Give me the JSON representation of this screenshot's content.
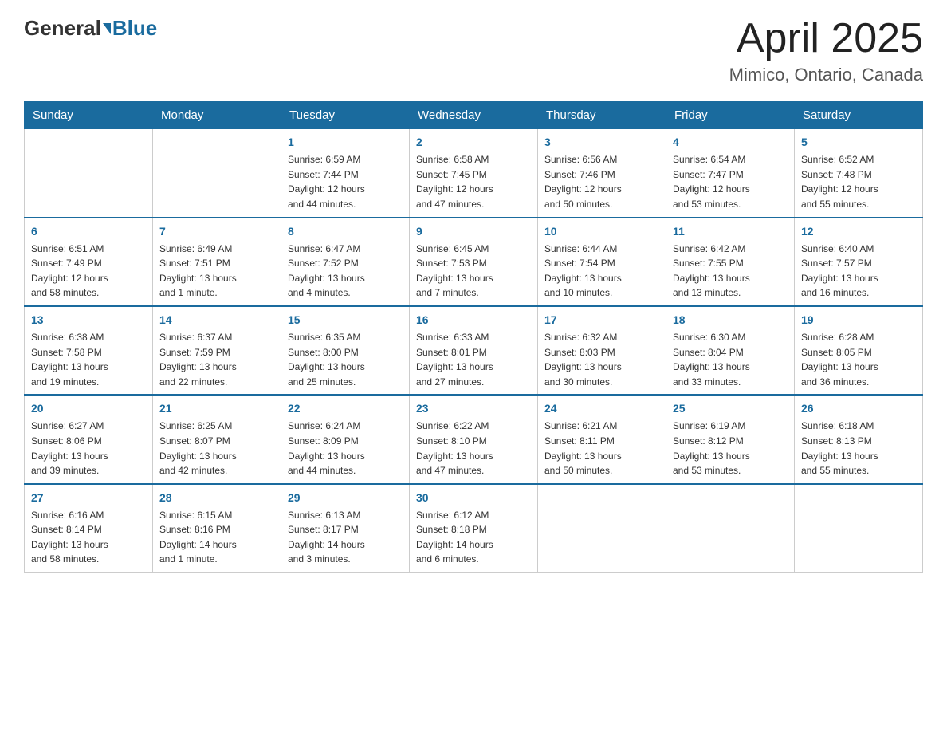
{
  "header": {
    "logo_general": "General",
    "logo_blue": "Blue",
    "month_title": "April 2025",
    "location": "Mimico, Ontario, Canada"
  },
  "weekdays": [
    "Sunday",
    "Monday",
    "Tuesday",
    "Wednesday",
    "Thursday",
    "Friday",
    "Saturday"
  ],
  "weeks": [
    [
      {
        "day": "",
        "info": ""
      },
      {
        "day": "",
        "info": ""
      },
      {
        "day": "1",
        "info": "Sunrise: 6:59 AM\nSunset: 7:44 PM\nDaylight: 12 hours\nand 44 minutes."
      },
      {
        "day": "2",
        "info": "Sunrise: 6:58 AM\nSunset: 7:45 PM\nDaylight: 12 hours\nand 47 minutes."
      },
      {
        "day": "3",
        "info": "Sunrise: 6:56 AM\nSunset: 7:46 PM\nDaylight: 12 hours\nand 50 minutes."
      },
      {
        "day": "4",
        "info": "Sunrise: 6:54 AM\nSunset: 7:47 PM\nDaylight: 12 hours\nand 53 minutes."
      },
      {
        "day": "5",
        "info": "Sunrise: 6:52 AM\nSunset: 7:48 PM\nDaylight: 12 hours\nand 55 minutes."
      }
    ],
    [
      {
        "day": "6",
        "info": "Sunrise: 6:51 AM\nSunset: 7:49 PM\nDaylight: 12 hours\nand 58 minutes."
      },
      {
        "day": "7",
        "info": "Sunrise: 6:49 AM\nSunset: 7:51 PM\nDaylight: 13 hours\nand 1 minute."
      },
      {
        "day": "8",
        "info": "Sunrise: 6:47 AM\nSunset: 7:52 PM\nDaylight: 13 hours\nand 4 minutes."
      },
      {
        "day": "9",
        "info": "Sunrise: 6:45 AM\nSunset: 7:53 PM\nDaylight: 13 hours\nand 7 minutes."
      },
      {
        "day": "10",
        "info": "Sunrise: 6:44 AM\nSunset: 7:54 PM\nDaylight: 13 hours\nand 10 minutes."
      },
      {
        "day": "11",
        "info": "Sunrise: 6:42 AM\nSunset: 7:55 PM\nDaylight: 13 hours\nand 13 minutes."
      },
      {
        "day": "12",
        "info": "Sunrise: 6:40 AM\nSunset: 7:57 PM\nDaylight: 13 hours\nand 16 minutes."
      }
    ],
    [
      {
        "day": "13",
        "info": "Sunrise: 6:38 AM\nSunset: 7:58 PM\nDaylight: 13 hours\nand 19 minutes."
      },
      {
        "day": "14",
        "info": "Sunrise: 6:37 AM\nSunset: 7:59 PM\nDaylight: 13 hours\nand 22 minutes."
      },
      {
        "day": "15",
        "info": "Sunrise: 6:35 AM\nSunset: 8:00 PM\nDaylight: 13 hours\nand 25 minutes."
      },
      {
        "day": "16",
        "info": "Sunrise: 6:33 AM\nSunset: 8:01 PM\nDaylight: 13 hours\nand 27 minutes."
      },
      {
        "day": "17",
        "info": "Sunrise: 6:32 AM\nSunset: 8:03 PM\nDaylight: 13 hours\nand 30 minutes."
      },
      {
        "day": "18",
        "info": "Sunrise: 6:30 AM\nSunset: 8:04 PM\nDaylight: 13 hours\nand 33 minutes."
      },
      {
        "day": "19",
        "info": "Sunrise: 6:28 AM\nSunset: 8:05 PM\nDaylight: 13 hours\nand 36 minutes."
      }
    ],
    [
      {
        "day": "20",
        "info": "Sunrise: 6:27 AM\nSunset: 8:06 PM\nDaylight: 13 hours\nand 39 minutes."
      },
      {
        "day": "21",
        "info": "Sunrise: 6:25 AM\nSunset: 8:07 PM\nDaylight: 13 hours\nand 42 minutes."
      },
      {
        "day": "22",
        "info": "Sunrise: 6:24 AM\nSunset: 8:09 PM\nDaylight: 13 hours\nand 44 minutes."
      },
      {
        "day": "23",
        "info": "Sunrise: 6:22 AM\nSunset: 8:10 PM\nDaylight: 13 hours\nand 47 minutes."
      },
      {
        "day": "24",
        "info": "Sunrise: 6:21 AM\nSunset: 8:11 PM\nDaylight: 13 hours\nand 50 minutes."
      },
      {
        "day": "25",
        "info": "Sunrise: 6:19 AM\nSunset: 8:12 PM\nDaylight: 13 hours\nand 53 minutes."
      },
      {
        "day": "26",
        "info": "Sunrise: 6:18 AM\nSunset: 8:13 PM\nDaylight: 13 hours\nand 55 minutes."
      }
    ],
    [
      {
        "day": "27",
        "info": "Sunrise: 6:16 AM\nSunset: 8:14 PM\nDaylight: 13 hours\nand 58 minutes."
      },
      {
        "day": "28",
        "info": "Sunrise: 6:15 AM\nSunset: 8:16 PM\nDaylight: 14 hours\nand 1 minute."
      },
      {
        "day": "29",
        "info": "Sunrise: 6:13 AM\nSunset: 8:17 PM\nDaylight: 14 hours\nand 3 minutes."
      },
      {
        "day": "30",
        "info": "Sunrise: 6:12 AM\nSunset: 8:18 PM\nDaylight: 14 hours\nand 6 minutes."
      },
      {
        "day": "",
        "info": ""
      },
      {
        "day": "",
        "info": ""
      },
      {
        "day": "",
        "info": ""
      }
    ]
  ]
}
